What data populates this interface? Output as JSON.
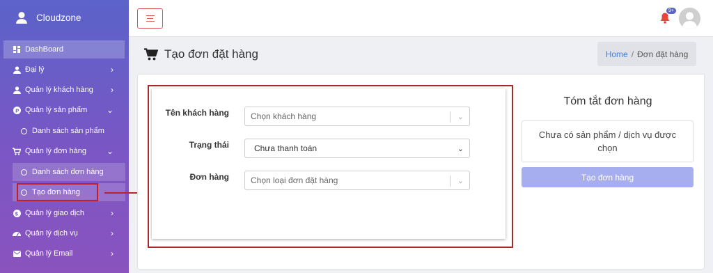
{
  "app": {
    "brand": "Cloudzone"
  },
  "sidebar": {
    "items": [
      {
        "label": "DashBoard",
        "icon": "dashboard-icon"
      },
      {
        "label": "Đại lý",
        "icon": "agent-icon"
      },
      {
        "label": "Quản lý khách hàng",
        "icon": "customer-icon"
      },
      {
        "label": "Quản lý sản phẩm",
        "icon": "product-icon"
      },
      {
        "label": "Danh sách sản phẩm"
      },
      {
        "label": "Quản lý đơn hàng",
        "icon": "cart-icon"
      },
      {
        "label": "Danh sách đơn hàng"
      },
      {
        "label": "Tạo đơn hàng"
      },
      {
        "label": "Quản lý giao dịch",
        "icon": "transaction-icon"
      },
      {
        "label": "Quản lý dịch vụ",
        "icon": "service-icon"
      },
      {
        "label": "Quản lý Email",
        "icon": "email-icon"
      }
    ]
  },
  "topbar": {
    "notification_count": "9+"
  },
  "page": {
    "title": "Tạo đơn đặt hàng",
    "breadcrumb": {
      "home": "Home",
      "separator": "/",
      "current": "Đơn đặt hàng"
    }
  },
  "form": {
    "customer_label": "Tên khách hàng",
    "customer_placeholder": "Chọn khách hàng",
    "status_label": "Trạng thái",
    "status_value": "Chưa thanh toán",
    "order_label": "Đơn hàng",
    "order_placeholder": "Chọn loại đơn đặt hàng"
  },
  "summary": {
    "title": "Tóm tắt đơn hàng",
    "empty_text": "Chưa có sản phẩm / dịch vụ được chọn",
    "submit_label": "Tạo đơn hàng"
  },
  "colors": {
    "accent": "#5b63c9",
    "highlight": "#c0202a",
    "button": "#a7aef0"
  }
}
